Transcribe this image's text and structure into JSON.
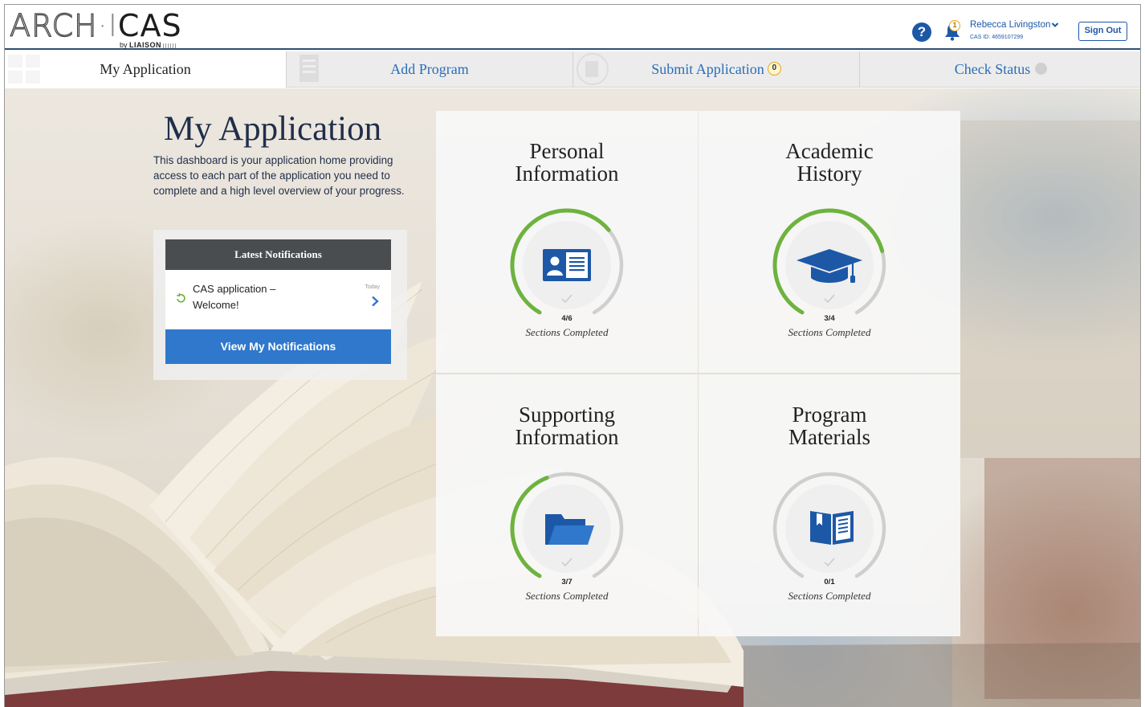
{
  "header": {
    "logo_main_left": "ARCH",
    "logo_separator": "·I",
    "logo_main_right": "CAS",
    "logo_by": "by",
    "logo_brand": "LIAISON",
    "help_label": "?",
    "notification_count": "1",
    "user_name": "Rebecca Livingston",
    "cas_id": "CAS ID: 4659107299",
    "sign_out_label": "Sign Out"
  },
  "tabs": [
    {
      "label": "My Application",
      "active": true
    },
    {
      "label": "Add Program",
      "active": false
    },
    {
      "label": "Submit Application",
      "active": false,
      "badge": "0"
    },
    {
      "label": "Check Status",
      "active": false
    }
  ],
  "intro": {
    "title": "My Application",
    "description": "This dashboard is your application home providing access to each part of the application you need to complete and a high level overview of your progress."
  },
  "notifications": {
    "heading": "Latest Notifications",
    "items": [
      {
        "text": "CAS application – Welcome!",
        "date": "Today"
      }
    ],
    "button_label": "View My Notifications"
  },
  "tiles": [
    {
      "title_line1": "Personal",
      "title_line2": "Information",
      "count": "4/6",
      "caption": "Sections Completed",
      "completed": 4,
      "total": 6,
      "icon": "id-card-icon"
    },
    {
      "title_line1": "Academic",
      "title_line2": "History",
      "count": "3/4",
      "caption": "Sections Completed",
      "completed": 3,
      "total": 4,
      "icon": "graduation-cap-icon"
    },
    {
      "title_line1": "Supporting",
      "title_line2": "Information",
      "count": "3/7",
      "caption": "Sections Completed",
      "completed": 3,
      "total": 7,
      "icon": "folder-icon"
    },
    {
      "title_line1": "Program",
      "title_line2": "Materials",
      "count": "0/1",
      "caption": "Sections Completed",
      "completed": 0,
      "total": 1,
      "icon": "book-icon"
    }
  ],
  "colors": {
    "accent": "#2f78cc",
    "link": "#2b6db8",
    "progress": "#6db33f",
    "track": "#cfcfcf",
    "header_rule": "#2d4f73"
  }
}
